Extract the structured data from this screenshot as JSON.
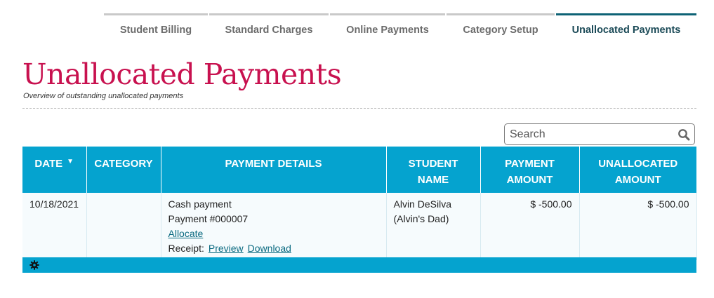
{
  "tabs": [
    {
      "label": "Student Billing",
      "active": false
    },
    {
      "label": "Standard Charges",
      "active": false
    },
    {
      "label": "Online Payments",
      "active": false
    },
    {
      "label": "Category Setup",
      "active": false
    },
    {
      "label": "Unallocated Payments",
      "active": true
    }
  ],
  "page": {
    "title": "Unallocated Payments",
    "subtitle": "Overview of outstanding unallocated payments"
  },
  "search": {
    "placeholder": "Search",
    "icon": "search-icon"
  },
  "table": {
    "columns": [
      {
        "label": "DATE",
        "sorted": "desc"
      },
      {
        "label": "CATEGORY"
      },
      {
        "label": "PAYMENT DETAILS"
      },
      {
        "label": "STUDENT NAME"
      },
      {
        "label": "PAYMENT AMOUNT"
      },
      {
        "label": "UNALLOCATED AMOUNT"
      }
    ],
    "rows": [
      {
        "date": "10/18/2021",
        "category": "",
        "details": {
          "type": "Cash payment",
          "number": "Payment #000007",
          "allocate_label": "Allocate",
          "receipt_label": "Receipt:",
          "preview_label": "Preview",
          "download_label": "Download"
        },
        "student_name": "Alvin DeSilva",
        "student_relation": "(Alvin's Dad)",
        "payment_amount": "$ -500.00",
        "unallocated_amount": "$ -500.00"
      }
    ]
  },
  "footer": {
    "icon": "gear-icon"
  },
  "colors": {
    "accent": "#05a3cf",
    "title": "#c8114f",
    "tab_active": "#0e6275",
    "link": "#0a6a80"
  }
}
